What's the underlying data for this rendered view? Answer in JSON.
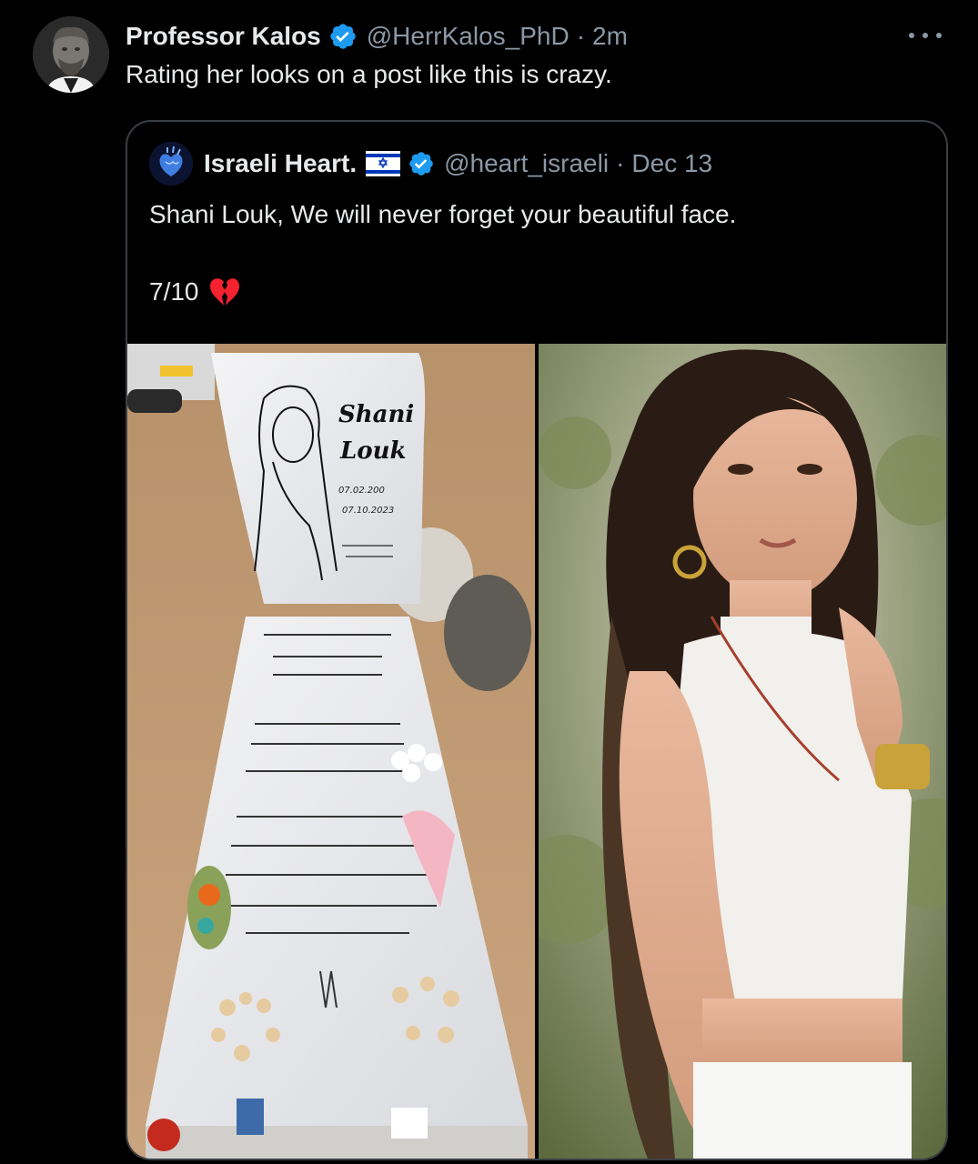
{
  "tweet": {
    "author_name": "Professor Kalos",
    "author_handle": "@HerrKalos_PhD",
    "separator": "·",
    "timestamp": "2m",
    "text": "Rating her looks on a post like this is crazy.",
    "avatar_icon": "bust-statue-avatar",
    "verified_icon": "verified-badge-icon",
    "more_icon": "more-options-icon"
  },
  "quoted": {
    "author_name": "Israeli Heart.",
    "flag_icon": "israel-flag-icon",
    "verified_icon": "verified-badge-icon",
    "author_handle": "@heart_israeli",
    "separator": "·",
    "timestamp": "Dec 13",
    "text": "Shani Louk, We will never forget your beautiful face.",
    "rating": "7/10",
    "emoji_icon": "broken-heart-icon",
    "media": [
      {
        "kind": "photo",
        "subject": "gravestone",
        "printed_text": [
          "Shani",
          "Louk",
          "07.02.200",
          "07.10.2023"
        ]
      },
      {
        "kind": "photo",
        "subject": "portrait"
      }
    ]
  },
  "colors": {
    "background": "#000000",
    "text_primary": "#e7e9ea",
    "text_secondary": "#8b98a5",
    "border": "#3a3f44",
    "verified_blue": "#1d9bf0",
    "heart_red": "#f4212e"
  }
}
